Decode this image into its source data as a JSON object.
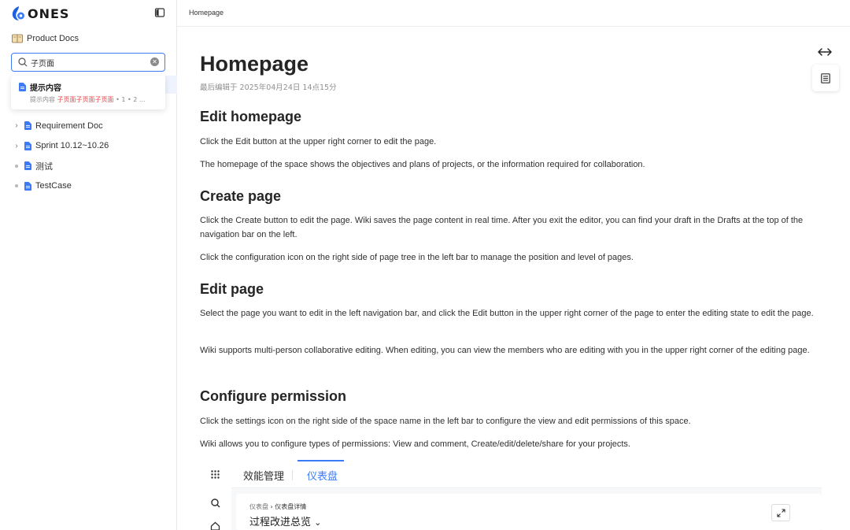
{
  "brand": {
    "name": "ONES",
    "accent": "#3d7bf6"
  },
  "sidebar": {
    "space_name": "Product Docs",
    "search": {
      "value": "子页面"
    },
    "suggestion": {
      "title": "提示内容",
      "prefix": "提示内容 ",
      "highlight": "子页面子页面子页面",
      "suffix": " • 1 • 2 ..."
    },
    "tree": [
      {
        "label": "Requirement Doc",
        "expandable": true
      },
      {
        "label": "Sprint 10.12~10.26",
        "expandable": true
      },
      {
        "label": "测试",
        "expandable": false
      },
      {
        "label": "TestCase",
        "expandable": false
      }
    ]
  },
  "header": {
    "breadcrumb": "Homepage"
  },
  "page": {
    "title": "Homepage",
    "edited": "最后编辑于 2025年04月24日 14点15分",
    "sections": [
      {
        "heading": "Edit homepage",
        "paragraphs": [
          "Click the Edit button at the upper right corner to edit the page.",
          "The homepage of the space shows the objectives and plans of projects, or the information required for collaboration."
        ]
      },
      {
        "heading": "Create page",
        "paragraphs": [
          "Click the Create button to edit the page. Wiki saves the page content in real time. After you exit the editor, you can find your draft in the Drafts at the top of the navigation bar on the left.",
          "Click the configuration icon on the right side of page tree in the left bar to manage the position and level of pages."
        ]
      },
      {
        "heading": "Edit page",
        "paragraphs": [
          "Select the page you want to edit in the left navigation bar, and click the Edit button in the upper right corner of the page to enter the editing state to edit the page.",
          "Wiki supports multi-person collaborative editing. When editing, you can view the members who are editing with you in the upper right corner of the editing page."
        ]
      },
      {
        "heading": "Configure permission",
        "paragraphs": [
          "Click the settings icon on the right side of the space name in the left bar to configure the view and edit permissions of this space.",
          "Wiki allows you to configure types of permissions: View and comment, Create/edit/delete/share for your projects."
        ]
      }
    ]
  },
  "embed": {
    "tabs": [
      "效能管理",
      "仪表盘"
    ],
    "crumb_parent": "仪表盘",
    "crumb_sep": " › ",
    "crumb_current": "仪表盘详情",
    "title": "过程改进总览",
    "title_caret": "⌄"
  }
}
